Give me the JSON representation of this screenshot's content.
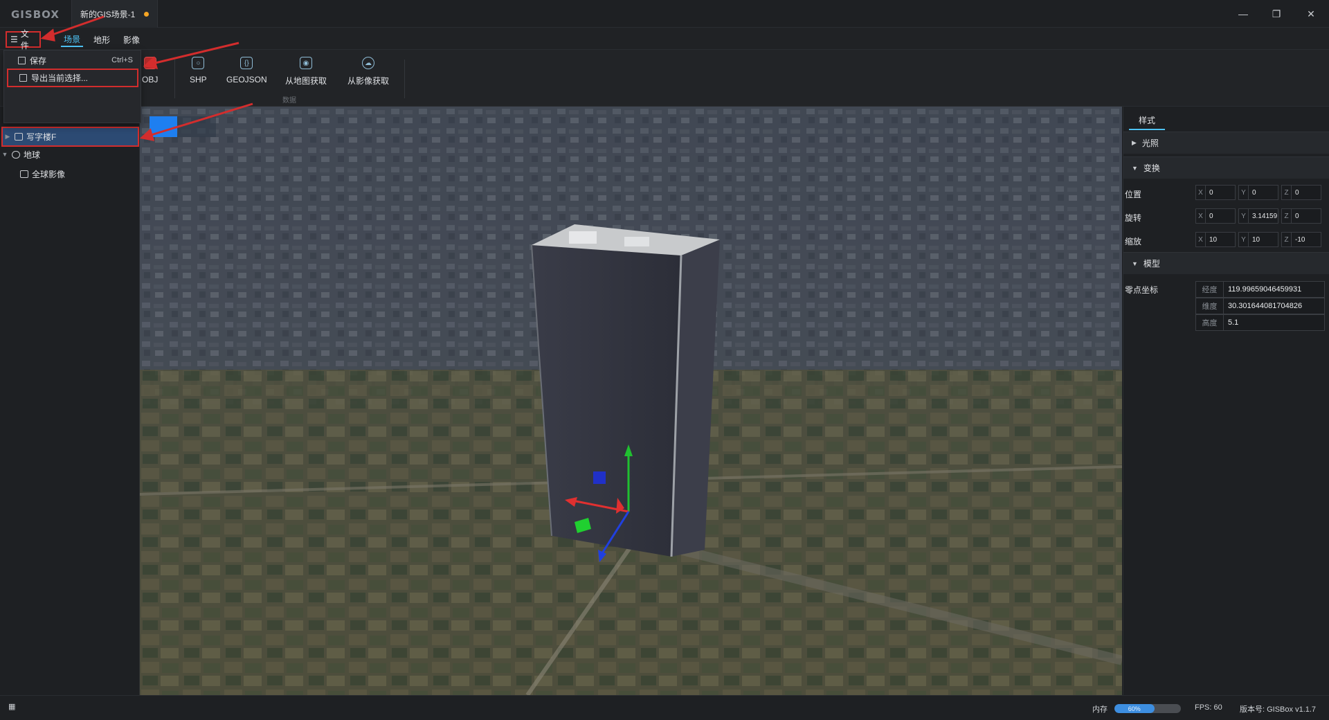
{
  "titlebar": {
    "logo": "GISBOX",
    "doc_tab": "新的GIS场景-1"
  },
  "menu": {
    "file": "文件",
    "scene": "场景",
    "terrain": "地形",
    "imagery": "影像"
  },
  "ribbon": {
    "obj": "OBJ",
    "shp": "SHP",
    "geojson": "GEOJSON",
    "from_map": "从地图获取",
    "from_imagery": "从影像获取",
    "group_label": "数据"
  },
  "file_menu": {
    "save": "保存",
    "save_shortcut": "Ctrl+S",
    "export": "导出当前选择..."
  },
  "tree": {
    "building": "写字楼F",
    "earth": "地球",
    "global_imagery": "全球影像"
  },
  "right_panel": {
    "tab": "样式",
    "lighting": "光照",
    "transform": "变换",
    "model": "模型",
    "position_label": "位置",
    "rotation_label": "旋转",
    "scale_label": "缩放",
    "origin_label": "零点坐标",
    "position": {
      "x": "0",
      "y": "0",
      "z": "0"
    },
    "rotation": {
      "x": "0",
      "y": "3.14159",
      "z": "0"
    },
    "scale": {
      "x": "10",
      "y": "10",
      "z": "-10"
    },
    "longitude_label": "经度",
    "longitude": "119.99659046459931",
    "latitude_label": "维度",
    "latitude": "30.301644081704826",
    "height_label": "高度",
    "height": "5.1"
  },
  "statusbar": {
    "memory_label": "内存",
    "memory_percent": "60%",
    "memory_fraction": 0.6,
    "fps": "FPS: 60",
    "version": "版本号: GISBox v1.1.7"
  },
  "colors": {
    "accent": "#4ec3f4",
    "highlight_box": "#d32d2d",
    "selection": "#2c4a73",
    "unsaved_dot": "#f5a524"
  }
}
